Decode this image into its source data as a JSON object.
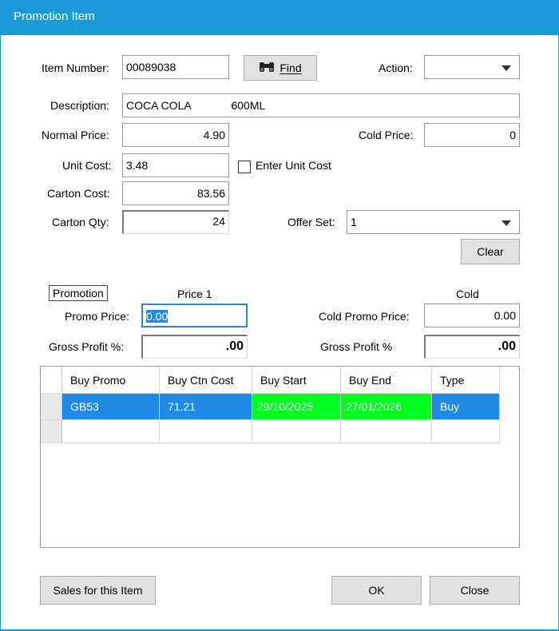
{
  "window": {
    "title": "Promotion Item"
  },
  "item": {
    "number_label": "Item Number:",
    "number_value": "00089038",
    "find_label": "Find",
    "action_label": "Action:",
    "action_value": "",
    "description_label": "Description:",
    "description_value": "COCA COLA             600ML",
    "normal_price_label": "Normal Price:",
    "normal_price_value": "4.90",
    "cold_price_label": "Cold Price:",
    "cold_price_value": "0",
    "unit_cost_label": "Unit Cost:",
    "unit_cost_value": "3.48",
    "enter_unit_cost_label": "Enter Unit Cost",
    "carton_cost_label": "Carton Cost:",
    "carton_cost_value": "83.56",
    "carton_qty_label": "Carton Qty:",
    "carton_qty_value": "24",
    "offer_set_label": "Offer Set:",
    "offer_set_value": "1",
    "clear_label": "Clear"
  },
  "promotion": {
    "group_label": "Promotion",
    "price1_header": "Price 1",
    "cold_header": "Cold",
    "promo_price_label": "Promo Price:",
    "promo_price_value": "0.00",
    "cold_promo_price_label": "Cold Promo Price:",
    "cold_promo_price_value": "0.00",
    "gross_profit_label": "Gross Profit %:",
    "gross_profit_value": ".00",
    "cold_gross_profit_label": "Gross Profit %",
    "cold_gross_profit_value": ".00"
  },
  "grid": {
    "columns": [
      "Buy Promo",
      "Buy Ctn Cost",
      "Buy Start",
      "Buy End",
      "Type"
    ],
    "rows": [
      {
        "buy_promo": "GB53",
        "buy_ctn_cost": "71.21",
        "buy_start": "29/10/2025",
        "buy_end": "27/01/2026",
        "type": "Buy"
      }
    ],
    "highlight_color": "#00ff1e",
    "selection_color": "#1e8ae6"
  },
  "footer": {
    "sales_label": "Sales for this Item",
    "ok_label": "OK",
    "close_label": "Close"
  },
  "colors": {
    "titlebar": "#1a9bd6"
  }
}
